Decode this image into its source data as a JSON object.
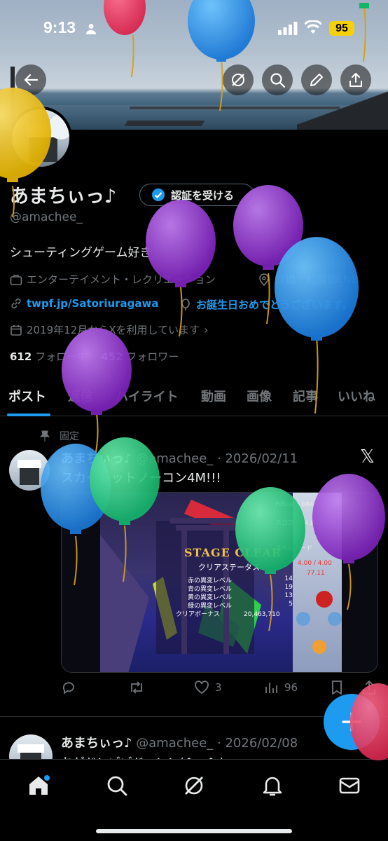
{
  "status": {
    "time": "9:13",
    "battery": "95"
  },
  "header": {
    "back_icon": "arrow-left-icon",
    "grok_icon": "grok-icon",
    "search_icon": "search-icon",
    "edit_icon": "pencil-icon",
    "share_icon": "share-icon"
  },
  "profile": {
    "name": "あまちぃっ♪",
    "verify_label": "認証を受ける",
    "handle": "@amachee_",
    "bio": "シューティングゲーム好き",
    "category": "エンターテイメント・レクリエーション",
    "location": "目標：紅魔郷LNB",
    "website": "twpf.jp/Satoriuragawa",
    "birthday": "お誕生日おめでとうございます。",
    "joined": "2019年12月からXを利用しています",
    "following_count": "612",
    "following_label": "フォロー中",
    "followers_count": "452",
    "followers_label": "フォロワー"
  },
  "tabs": [
    {
      "label": "ポスト"
    },
    {
      "label": "返信"
    },
    {
      "label": "ハイライト"
    },
    {
      "label": "動画"
    },
    {
      "label": "画像"
    },
    {
      "label": "記事"
    },
    {
      "label": "いいね"
    }
  ],
  "posts": [
    {
      "pinned_label": "固定",
      "name": "あまちぃっ♪",
      "handle": "@amachee_",
      "date": "2026/02/11",
      "text": "スカーレットノーコン4M!!!",
      "game": {
        "title": "STAGE CLEAR",
        "subtitle": "クリアステータス",
        "rows": [
          {
            "label": "赤の異変レベル",
            "value": "14"
          },
          {
            "label": "青の異変レベル",
            "value": "19"
          },
          {
            "label": "黄の異変レベル",
            "value": "13"
          },
          {
            "label": "緑の異変レベル",
            "value": "5"
          }
        ],
        "bonus_label": "クリアボーナス",
        "bonus_value": "20,463,710",
        "hiscore_label": "HiScore",
        "hiscore": "684,817,530",
        "score_label": "スコア",
        "score": "684,817,530",
        "spellcard_label": "スペルカード",
        "power": "4.00 / 4.00",
        "value2": "77.11"
      },
      "replies": "",
      "reposts": "",
      "likes": "3",
      "views": "96"
    },
    {
      "name": "あまちぃっ♪",
      "handle": "@amachee_",
      "date": "2026/02/08",
      "text": "おゲドンゾゾドーンン(^ヘ^ )"
    }
  ],
  "nav": [
    "home-icon",
    "search-icon",
    "grok-icon",
    "bell-icon",
    "mail-icon"
  ],
  "colors": {
    "accent": "#1d9bf0",
    "background": "#000000",
    "battery": "#f5d10c"
  }
}
